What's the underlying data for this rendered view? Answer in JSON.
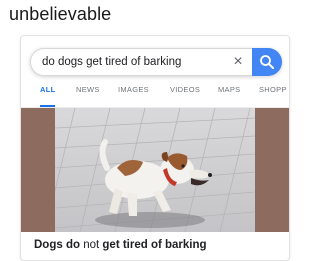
{
  "caption": "unbelievable",
  "search": {
    "query": "do dogs get tired of barking",
    "clear_label": "×"
  },
  "tabs": [
    {
      "label": "ALL",
      "active": true
    },
    {
      "label": "NEWS",
      "active": false
    },
    {
      "label": "IMAGES",
      "active": false
    },
    {
      "label": "VIDEOS",
      "active": false
    },
    {
      "label": "MAPS",
      "active": false
    },
    {
      "label": "SHOPP",
      "active": false
    }
  ],
  "result": {
    "title_part1": "Dogs do",
    "title_part2": "not",
    "title_part3": "get tired of barking",
    "image": "jack-russell-terrier-barking"
  },
  "colors": {
    "accent": "#4285f4",
    "active_tab": "#1a73e8",
    "image_background": "#8d6b5e"
  },
  "icons": {
    "search": "magnifier-icon",
    "clear": "close-icon"
  }
}
